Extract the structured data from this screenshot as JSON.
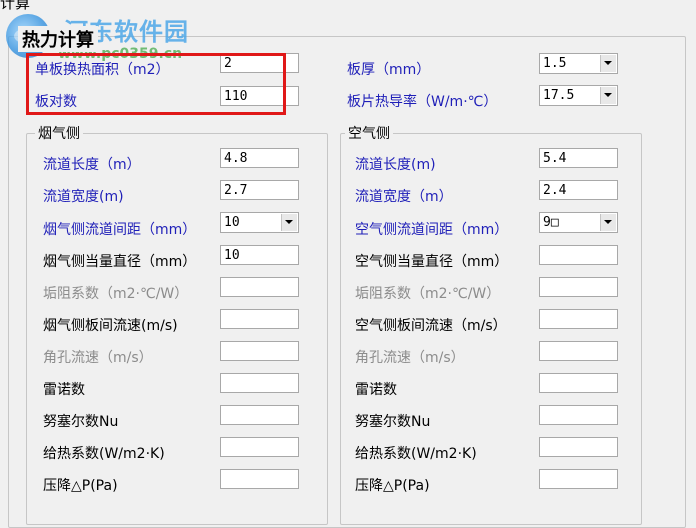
{
  "window": {
    "title_fragment": "计算"
  },
  "watermark": {
    "text": "河东软件园",
    "url": "www.pc0359.cn"
  },
  "section_title": "热力计算",
  "top": {
    "area_label": "单板换热面积（m2）",
    "area_value": "2",
    "count_label": "板对数",
    "count_value": "110",
    "thickness_label": "板厚（mm）",
    "thickness_value": "1.5",
    "conductivity_label": "板片热导率（W/m·℃）",
    "conductivity_value": "17.5"
  },
  "flue": {
    "legend": "烟气侧",
    "rows": [
      {
        "label": "流道长度（m）",
        "value": "4.8"
      },
      {
        "label": "流道宽度(m)",
        "value": "2.7"
      },
      {
        "label": "烟气侧流道间距（mm）",
        "value": "10"
      },
      {
        "label": "烟气侧当量直径（mm）",
        "value": "10"
      },
      {
        "label": "垢阻系数（m2·℃/W）",
        "value": ""
      },
      {
        "label": "烟气侧板间流速(m/s)",
        "value": ""
      },
      {
        "label": "角孔流速（m/s）",
        "value": ""
      },
      {
        "label": "雷诺数",
        "value": ""
      },
      {
        "label": "努塞尔数Nu",
        "value": ""
      },
      {
        "label": "给热系数(W/m2·K)",
        "value": ""
      },
      {
        "label": "压降△P(Pa)",
        "value": ""
      }
    ]
  },
  "air": {
    "legend": "空气侧",
    "rows": [
      {
        "label": "流道长度(m)",
        "value": "5.4"
      },
      {
        "label": "流道宽度（m）",
        "value": "2.4"
      },
      {
        "label": "空气侧流道间距（mm）",
        "value": "9□"
      },
      {
        "label": "空气侧当量直径（mm）",
        "value": ""
      },
      {
        "label": "垢阻系数（m2·℃/W）",
        "value": ""
      },
      {
        "label": "空气侧板间流速（m/s）",
        "value": ""
      },
      {
        "label": "角孔流速（m/s）",
        "value": ""
      },
      {
        "label": "雷诺数",
        "value": ""
      },
      {
        "label": "努塞尔数Nu",
        "value": ""
      },
      {
        "label": "给热系数(W/m2·K)",
        "value": ""
      },
      {
        "label": "压降△P(Pa)",
        "value": ""
      }
    ]
  },
  "colors": {
    "label_blue": "#1f1fb8",
    "label_gray": "#8c8c8c",
    "highlight_red": "#e01818"
  }
}
